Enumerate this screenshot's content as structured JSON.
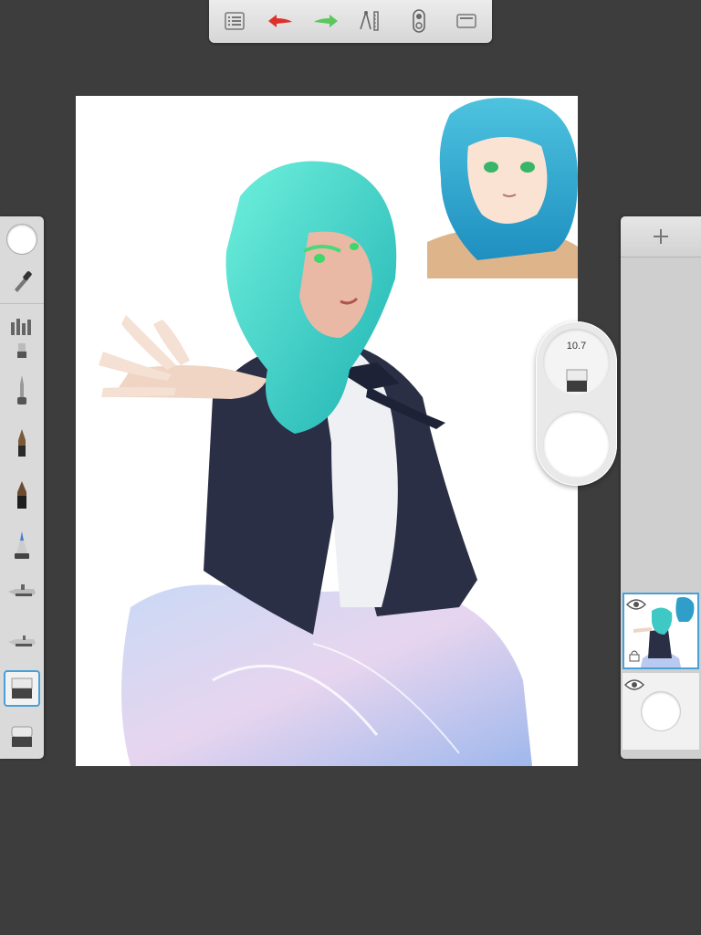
{
  "toolbar": {
    "items": [
      {
        "name": "menu-icon"
      },
      {
        "name": "undo-icon"
      },
      {
        "name": "redo-icon"
      },
      {
        "name": "ruler-tools-icon"
      },
      {
        "name": "mirror-symmetry-icon"
      },
      {
        "name": "fullscreen-icon"
      }
    ]
  },
  "colors": {
    "undo": "#e0302a",
    "redo": "#5cc75c",
    "selection": "#4aa0d8",
    "background": "#3d3d3d",
    "hair": "#3fc9c4"
  },
  "puck": {
    "brush_size": "10.7",
    "active_tool": "eraser-icon"
  },
  "brushes": [
    "color-swatch",
    "eyedropper-icon",
    "brush-library-icon",
    "marker-brush-icon",
    "pencil-brush-icon",
    "pen-brush-icon",
    "fine-pen-brush-icon",
    "paint-brush-icon",
    "airbrush-icon",
    "smudge-icon",
    "eraser-icon",
    "hard-eraser-icon"
  ],
  "layers": [
    {
      "name": "artwork-layer",
      "visible": true,
      "selected": true
    },
    {
      "name": "background-layer",
      "visible": true,
      "selected": false
    }
  ]
}
